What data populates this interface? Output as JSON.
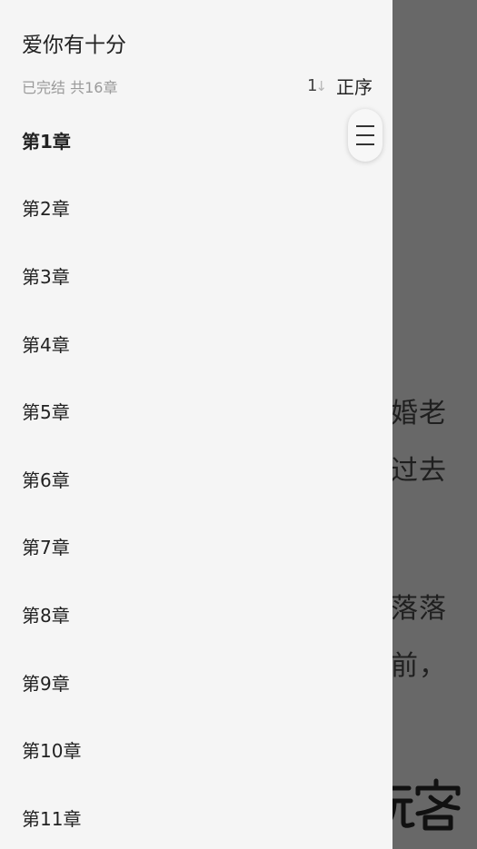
{
  "book": {
    "title": "爱你有十分",
    "meta": "已完结 共16章"
  },
  "sort": {
    "icon": "sort-order-icon",
    "label": "正序"
  },
  "chapters": [
    "第1章",
    "第2章",
    "第3章",
    "第4章",
    "第5章",
    "第6章",
    "第7章",
    "第8章",
    "第9章",
    "第10章",
    "第11章"
  ],
  "reader": {
    "lines": [
      "婚老",
      "过去",
      "落落",
      "前，"
    ]
  },
  "watermark": "大玩客"
}
